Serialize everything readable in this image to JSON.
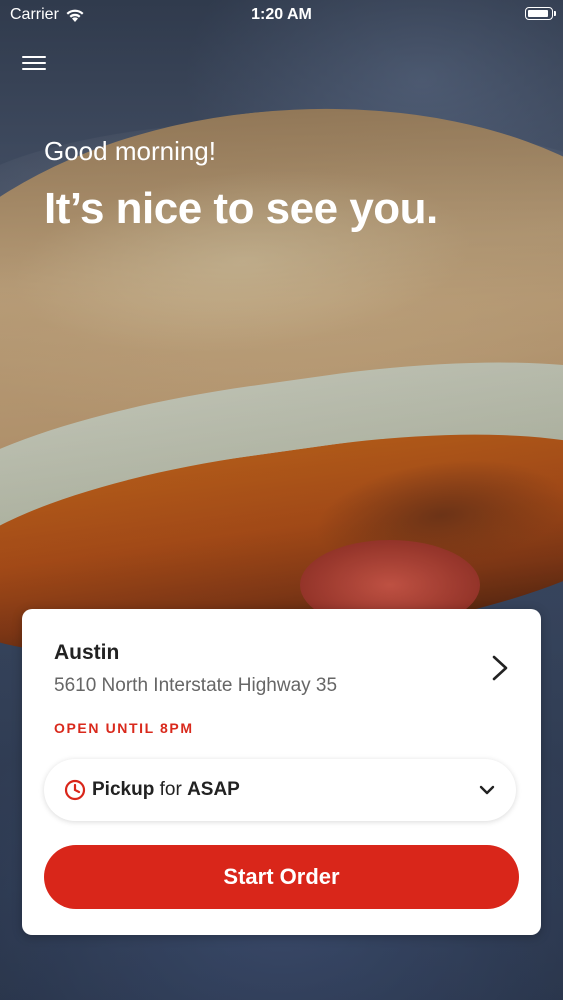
{
  "status_bar": {
    "carrier": "Carrier",
    "time": "1:20 AM"
  },
  "hero": {
    "greeting": "Good morning!",
    "headline": "It’s nice to see you."
  },
  "location_card": {
    "store_name": "Austin",
    "address": "5610 North Interstate Highway 35",
    "hours": "OPEN UNTIL 8PM",
    "pickup": {
      "mode": "Pickup",
      "connector": "for",
      "time": "ASAP"
    },
    "start_order_label": "Start Order"
  },
  "icons": {
    "menu": "hamburger-icon",
    "wifi": "wifi-icon",
    "battery": "battery-icon",
    "store_chevron": "chevron-right-icon",
    "clock": "clock-icon",
    "pickup_dropdown": "chevron-down-icon"
  },
  "colors": {
    "accent": "#d9261a",
    "text_dark": "#222222",
    "text_muted": "#666666"
  }
}
